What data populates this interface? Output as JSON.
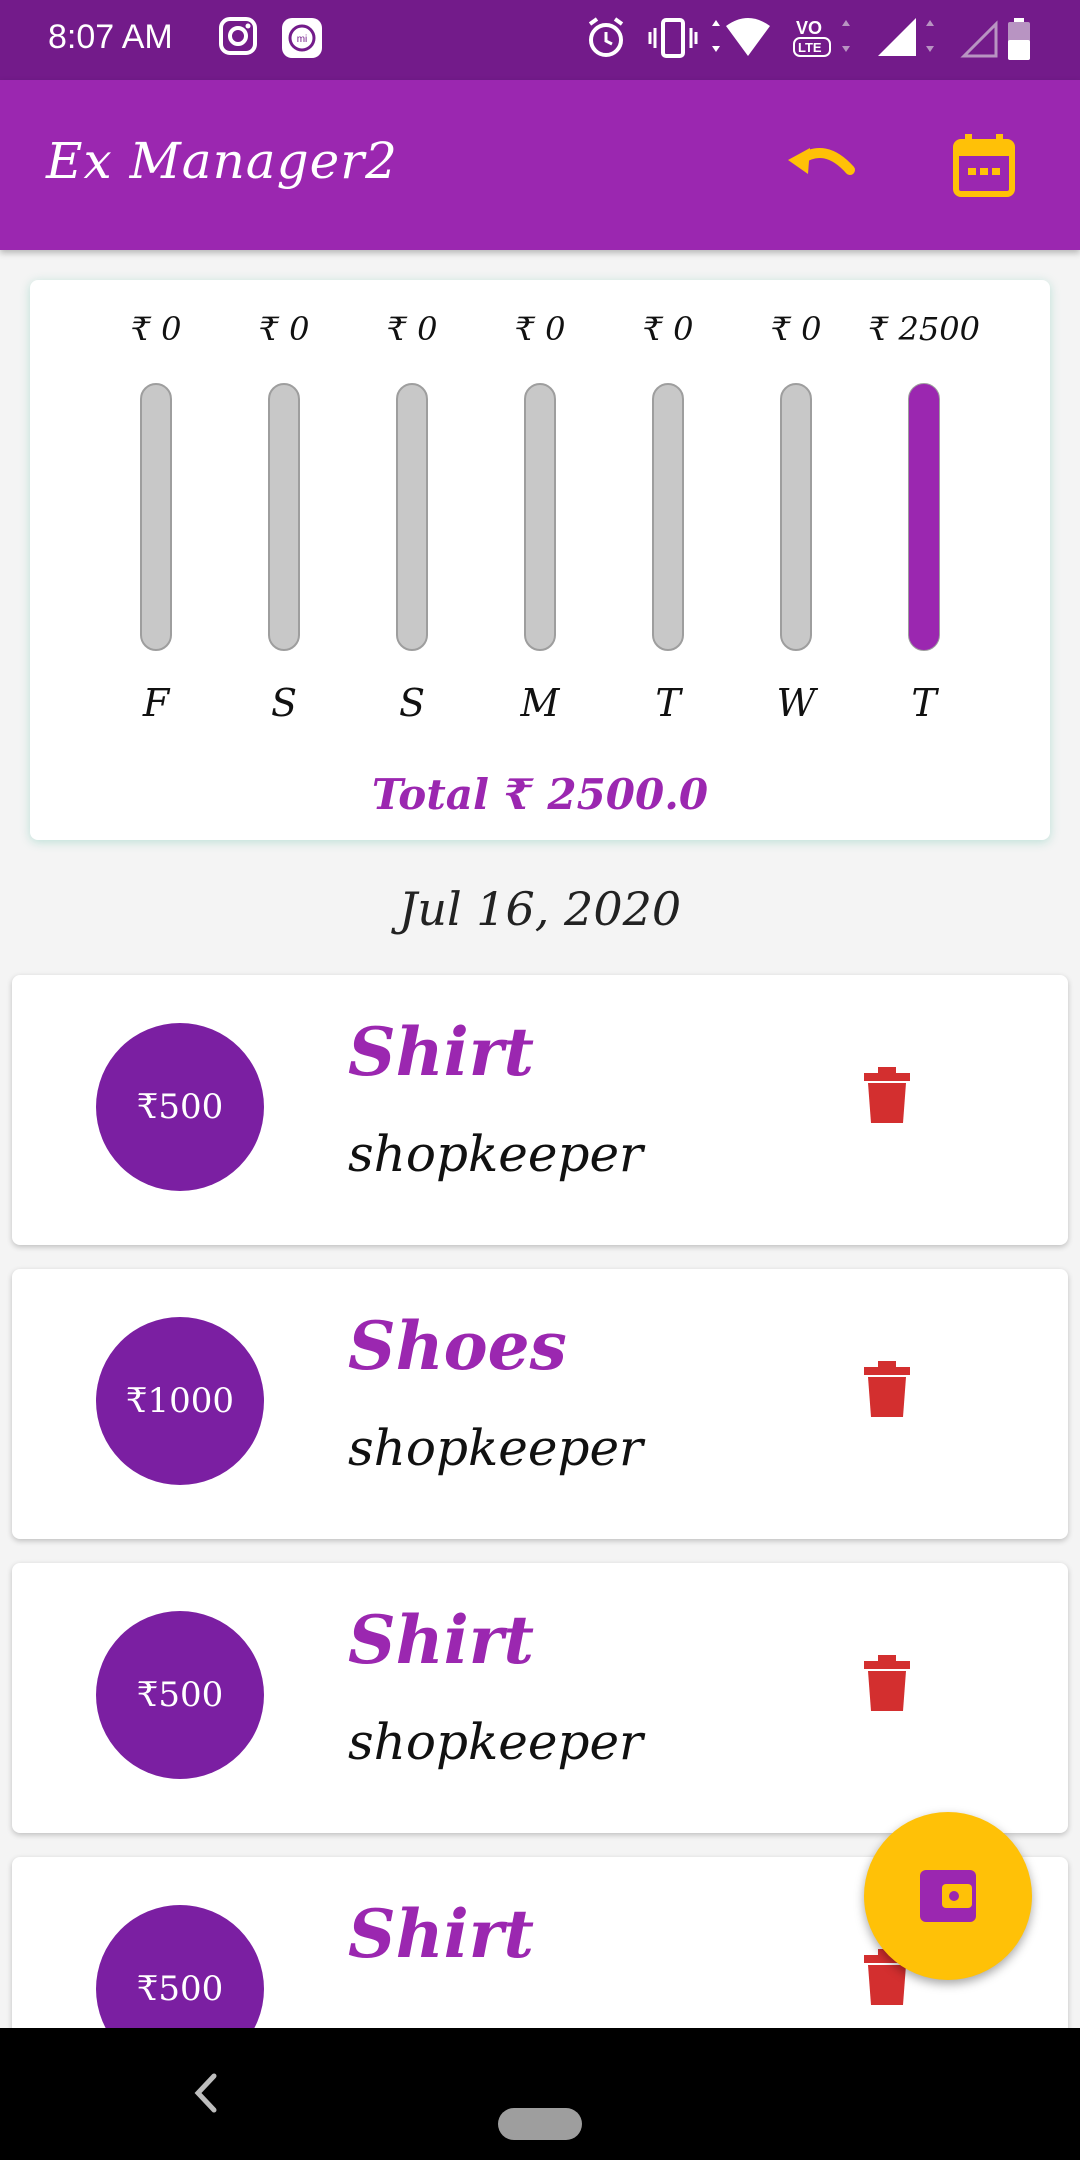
{
  "status_bar": {
    "time": "8:07 AM",
    "icons": [
      "instagram-icon",
      "mi-icon",
      "alarm-icon",
      "vibrate-icon",
      "wifi-icon",
      "volte-icon",
      "signal-icon",
      "signal-empty-icon",
      "battery-icon"
    ]
  },
  "app_bar": {
    "title": "Ex Manager2",
    "actions": [
      "undo-icon",
      "calendar-icon"
    ],
    "accent_color": "#ffc107",
    "bar_color": "#9b27b0"
  },
  "chart_data": {
    "type": "bar",
    "categories": [
      "F",
      "S",
      "S",
      "M",
      "T",
      "W",
      "T"
    ],
    "values": [
      0,
      0,
      0,
      0,
      0,
      0,
      2500
    ],
    "value_labels": [
      "₹ 0",
      "₹ 0",
      "₹ 0",
      "₹ 0",
      "₹ 0",
      "₹ 0",
      "₹ 2500"
    ],
    "max": 2500,
    "fill_color": "#9b27b0",
    "empty_color": "#c8c8c8",
    "total_label": "Total ₹ 2500.0"
  },
  "date_header": "Jul 16, 2020",
  "expenses": [
    {
      "amount": "₹500",
      "title": "Shirt",
      "subtitle": "shopkeeper"
    },
    {
      "amount": "₹1000",
      "title": "Shoes",
      "subtitle": "shopkeeper"
    },
    {
      "amount": "₹500",
      "title": "Shirt",
      "subtitle": "shopkeeper"
    },
    {
      "amount": "₹500",
      "title": "Shirt",
      "subtitle": ""
    }
  ],
  "fab_icon": "wallet-icon",
  "nav": {
    "back": "back-icon",
    "home": "home-pill"
  }
}
